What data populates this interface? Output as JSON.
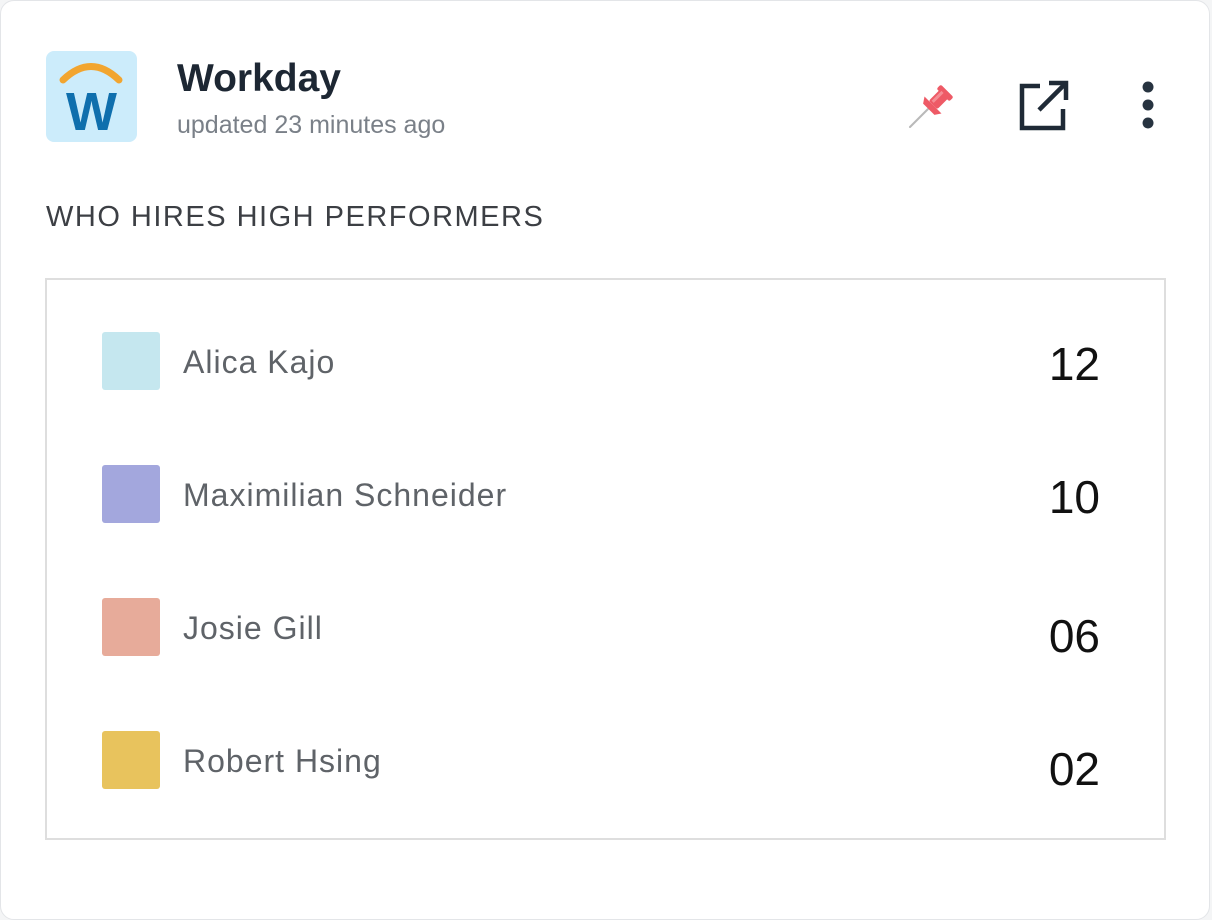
{
  "app": {
    "title": "Workday",
    "subtitle": "updated 23 minutes ago",
    "logo_letter": "W",
    "logo_colors": {
      "background": "#ccecfb",
      "letter": "#0f6fad",
      "arc": "#f2a52f"
    }
  },
  "header_actions": {
    "pin_icon": "pushpin-icon",
    "open_icon": "external-link-icon",
    "more_icon": "more-vertical-icon",
    "pin_color": "#ee5a66"
  },
  "section": {
    "title": "WHO HIRES HIGH PERFORMERS"
  },
  "items": [
    {
      "name": "Alica Kajo",
      "value": "12",
      "color": "#c5e7ef"
    },
    {
      "name": "Maximilian Schneider",
      "value": "10",
      "color": "#a3a7dd"
    },
    {
      "name": "Josie Gill",
      "value": "06",
      "color": "#e7ab9a"
    },
    {
      "name": "Robert Hsing",
      "value": "02",
      "color": "#e8c35d"
    }
  ]
}
